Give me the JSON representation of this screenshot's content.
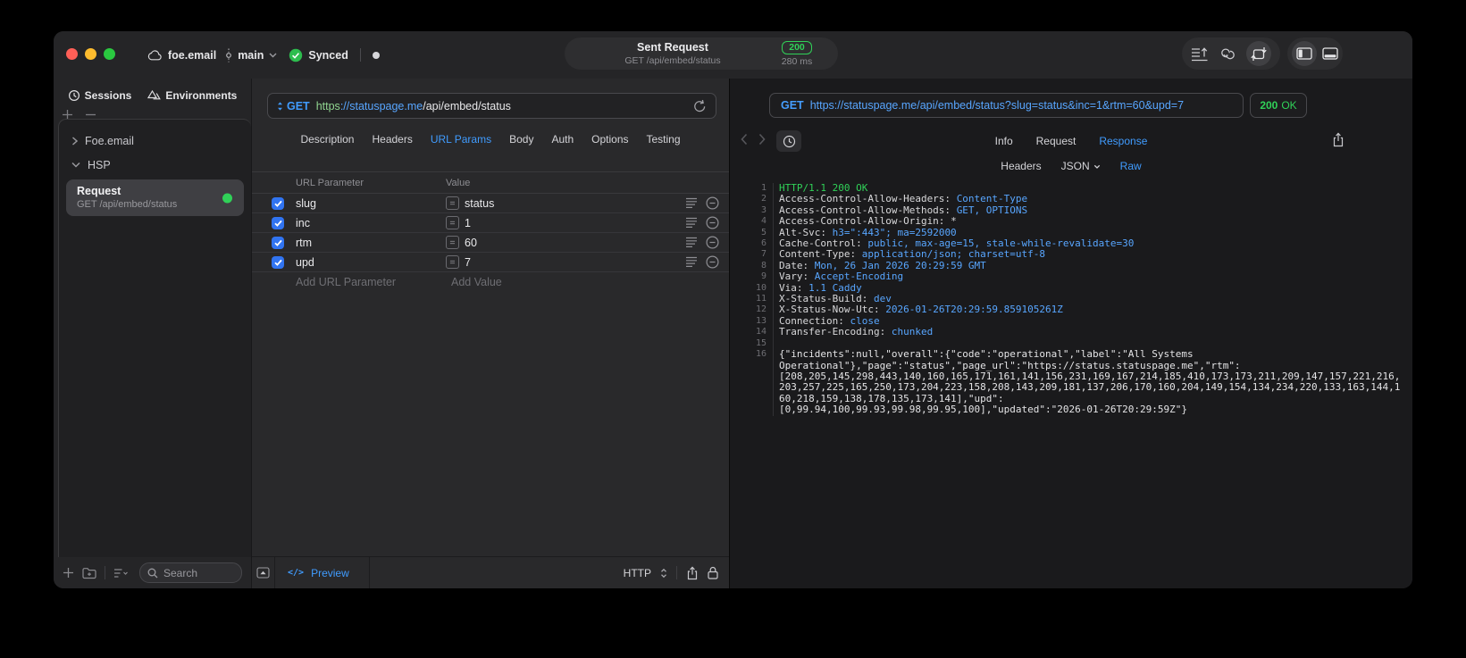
{
  "colors": {
    "accent_blue": "#409cff",
    "success_green": "#30d158",
    "url_blue": "#58a6ff",
    "scheme_green": "#90d590"
  },
  "titlebar": {
    "project": "foe.email",
    "branch": "main",
    "sync": "Synced",
    "request_pill": {
      "title": "Sent Request",
      "subtitle": "GET /api/embed/status",
      "code": "200",
      "time": "280 ms"
    }
  },
  "sidebar": {
    "tabs": [
      {
        "label": "Sessions"
      },
      {
        "label": "Environments"
      }
    ],
    "tree": [
      {
        "label": "Foe.email",
        "expanded": false
      },
      {
        "label": "HSP",
        "expanded": true
      },
      {
        "title": "Request",
        "subtitle": "GET /api/embed/status",
        "selected": true
      }
    ],
    "search_placeholder": "Search"
  },
  "request_editor": {
    "method": "GET",
    "url": {
      "scheme": "https",
      "host": "://statuspage.me",
      "path": "/api/embed/status"
    },
    "tabs": [
      "Description",
      "Headers",
      "URL Params",
      "Body",
      "Auth",
      "Options",
      "Testing"
    ],
    "active_tab": "URL Params",
    "params": {
      "col_name": "URL Parameter",
      "col_value": "Value",
      "eq_symbol": "=",
      "rows": [
        {
          "enabled": true,
          "name": "slug",
          "value": "status"
        },
        {
          "enabled": true,
          "name": "inc",
          "value": "1"
        },
        {
          "enabled": true,
          "name": "rtm",
          "value": "60"
        },
        {
          "enabled": true,
          "name": "upd",
          "value": "7"
        }
      ],
      "add_name_placeholder": "Add URL Parameter",
      "add_value_placeholder": "Add Value"
    },
    "footer": {
      "preview_icon": "</>",
      "preview": "Preview",
      "protocol": "HTTP"
    }
  },
  "response_viewer": {
    "request_line": {
      "method": "GET",
      "url": "https://statuspage.me/api/embed/status?slug=status&inc=1&rtm=60&upd=7"
    },
    "status": {
      "code": "200",
      "label": "OK"
    },
    "tabs": [
      "Info",
      "Request",
      "Response"
    ],
    "active_tab": "Response",
    "subtabs": [
      "Headers",
      "JSON",
      "Raw"
    ],
    "active_subtab": "Raw",
    "body_lines": [
      {
        "n": "1",
        "parts": [
          {
            "t": "HTTP/1.1 200 OK",
            "c": "status"
          }
        ]
      },
      {
        "n": "2",
        "parts": [
          {
            "t": "Access-Control-Allow-Headers: ",
            "c": "key"
          },
          {
            "t": "Content-Type",
            "c": "val"
          }
        ]
      },
      {
        "n": "3",
        "parts": [
          {
            "t": "Access-Control-Allow-Methods: ",
            "c": "key"
          },
          {
            "t": "GET, OPTIONS",
            "c": "val"
          }
        ]
      },
      {
        "n": "4",
        "parts": [
          {
            "t": "Access-Control-Allow-Origin: ",
            "c": "key"
          },
          {
            "t": "*",
            "c": "key"
          }
        ]
      },
      {
        "n": "5",
        "parts": [
          {
            "t": "Alt-Svc: ",
            "c": "key"
          },
          {
            "t": "h3=\":443\"; ma=2592000",
            "c": "val"
          }
        ]
      },
      {
        "n": "6",
        "parts": [
          {
            "t": "Cache-Control: ",
            "c": "key"
          },
          {
            "t": "public, max-age=15, stale-while-revalidate=30",
            "c": "val"
          }
        ]
      },
      {
        "n": "7",
        "parts": [
          {
            "t": "Content-Type: ",
            "c": "key"
          },
          {
            "t": "application/json; charset=utf-8",
            "c": "val"
          }
        ]
      },
      {
        "n": "8",
        "parts": [
          {
            "t": "Date: ",
            "c": "key"
          },
          {
            "t": "Mon, 26 Jan 2026 20:29:59 GMT",
            "c": "val"
          }
        ]
      },
      {
        "n": "9",
        "parts": [
          {
            "t": "Vary: ",
            "c": "key"
          },
          {
            "t": "Accept-Encoding",
            "c": "val"
          }
        ]
      },
      {
        "n": "10",
        "parts": [
          {
            "t": "Via: ",
            "c": "key"
          },
          {
            "t": "1.1 Caddy",
            "c": "val"
          }
        ]
      },
      {
        "n": "11",
        "parts": [
          {
            "t": "X-Status-Build: ",
            "c": "key"
          },
          {
            "t": "dev",
            "c": "val"
          }
        ]
      },
      {
        "n": "12",
        "parts": [
          {
            "t": "X-Status-Now-Utc: ",
            "c": "key"
          },
          {
            "t": "2026-01-26T20:29:59.859105261Z",
            "c": "val"
          }
        ]
      },
      {
        "n": "13",
        "parts": [
          {
            "t": "Connection: ",
            "c": "key"
          },
          {
            "t": "close",
            "c": "val"
          }
        ]
      },
      {
        "n": "14",
        "parts": [
          {
            "t": "Transfer-Encoding: ",
            "c": "key"
          },
          {
            "t": "chunked",
            "c": "val"
          }
        ]
      },
      {
        "n": "15",
        "parts": []
      },
      {
        "n": "16",
        "parts": [
          {
            "t": "{\"incidents\":null,\"overall\":{\"code\":\"operational\",\"label\":\"All Systems",
            "c": "plain"
          }
        ]
      },
      {
        "n": "",
        "parts": [
          {
            "t": "Operational\"},\"page\":\"status\",\"page_url\":\"https://status.statuspage.me\",\"rtm\":",
            "c": "plain"
          }
        ]
      },
      {
        "n": "",
        "parts": [
          {
            "t": "[208,205,145,298,443,140,160,165,171,161,141,156,231,169,167,214,185,410,173,173,211,209,147,157,221,216,",
            "c": "plain"
          }
        ]
      },
      {
        "n": "",
        "parts": [
          {
            "t": "203,257,225,165,250,173,204,223,158,208,143,209,181,137,206,170,160,204,149,154,134,234,220,133,163,144,1",
            "c": "plain"
          }
        ]
      },
      {
        "n": "",
        "parts": [
          {
            "t": "60,218,159,138,178,135,173,141],\"upd\":",
            "c": "plain"
          }
        ]
      },
      {
        "n": "",
        "parts": [
          {
            "t": "[0,99.94,100,99.93,99.98,99.95,100],\"updated\":\"2026-01-26T20:29:59Z\"}",
            "c": "plain"
          }
        ]
      }
    ]
  }
}
